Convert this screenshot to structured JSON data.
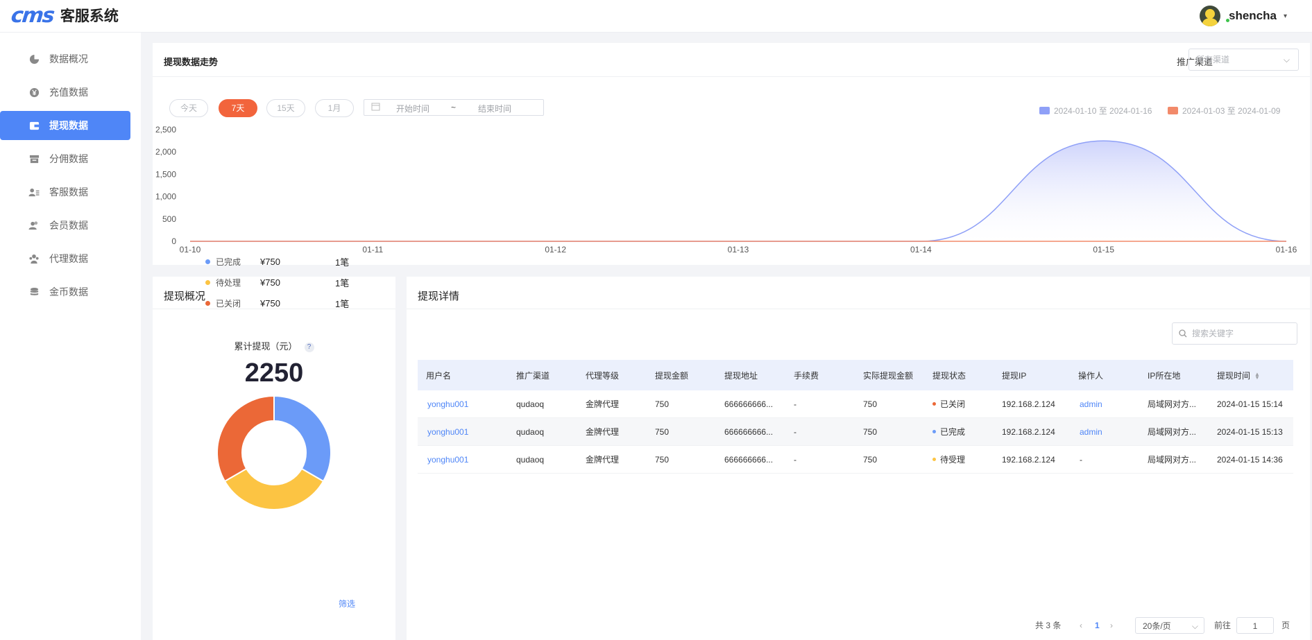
{
  "app": {
    "logo_mark": "cms",
    "title": "客服系统"
  },
  "user": {
    "name": "shencha",
    "caret": "▾"
  },
  "sidebar": {
    "items": [
      {
        "label": "数据概况",
        "icon": "pie-chart-icon",
        "active": false
      },
      {
        "label": "充值数据",
        "icon": "yen-coin-icon",
        "active": false
      },
      {
        "label": "提现数据",
        "icon": "wallet-icon",
        "active": true
      },
      {
        "label": "分佣数据",
        "icon": "archive-box-icon",
        "active": false
      },
      {
        "label": "客服数据",
        "icon": "user-list-icon",
        "active": false
      },
      {
        "label": "会员数据",
        "icon": "users-icon",
        "active": false
      },
      {
        "label": "代理数据",
        "icon": "agent-group-icon",
        "active": false
      },
      {
        "label": "金币数据",
        "icon": "coin-stack-icon",
        "active": false
      }
    ]
  },
  "trend": {
    "title": "提现数据走势",
    "channel_label": "推广渠道",
    "channel_select": {
      "value": "所有渠道"
    },
    "ranges": [
      "今天",
      "7天",
      "15天",
      "1月"
    ],
    "active_range": "7天",
    "date_range": {
      "start_placeholder": "开始时间",
      "separator": "~",
      "end_placeholder": "结束时间"
    }
  },
  "chart_data": {
    "type": "area",
    "x": [
      "01-10",
      "01-11",
      "01-12",
      "01-13",
      "01-14",
      "01-15",
      "01-16"
    ],
    "series": [
      {
        "name": "2024-01-10 至 2024-01-16",
        "values": [
          0,
          0,
          0,
          0,
          0,
          2250,
          0
        ],
        "color": "#8fa0f7"
      },
      {
        "name": "2024-01-03 至 2024-01-09",
        "values": [
          0,
          0,
          0,
          0,
          0,
          0,
          0
        ],
        "color": "#f28a6a"
      }
    ],
    "yticks": [
      "2,500",
      "2,000",
      "1,500",
      "1,000",
      "500",
      "0"
    ],
    "ylim": [
      0,
      2500
    ],
    "grid": false,
    "legend": "top-right",
    "smooth": true
  },
  "summary": {
    "title": "提现概况",
    "total_label": "累计提现（元）",
    "help": "?",
    "total": "2250",
    "donut": [
      {
        "label": "已完成",
        "value": 750,
        "color": "#6b9bf8"
      },
      {
        "label": "待处理",
        "value": 750,
        "color": "#fcc443"
      },
      {
        "label": "已关闭",
        "value": 750,
        "color": "#eb6837"
      }
    ],
    "stats": [
      {
        "label": "已完成",
        "amount": "¥750",
        "count": "1笔",
        "color": "#6b9bf8"
      },
      {
        "label": "待处理",
        "amount": "¥750",
        "count": "1笔",
        "color": "#fcc443"
      },
      {
        "label": "已关闭",
        "amount": "¥750",
        "count": "1笔",
        "color": "#eb6837"
      }
    ],
    "filter_label": "筛选"
  },
  "detail": {
    "title": "提现详情",
    "search_placeholder": "搜索关键字",
    "columns": [
      "用户名",
      "推广渠道",
      "代理等级",
      "提现金额",
      "提现地址",
      "手续费",
      "实际提现金额",
      "提现状态",
      "提现IP",
      "操作人",
      "IP所在地",
      "提现时间"
    ],
    "rows": [
      {
        "user": "yonghu001",
        "channel": "qudaoq",
        "level": "金牌代理",
        "amount": "750",
        "address": "666666666...",
        "fee": "-",
        "actual": "750",
        "status": "已关闭",
        "status_color": "#eb6837",
        "ip": "192.168.2.124",
        "operator": "admin",
        "location": "局域网对方...",
        "time": "2024-01-15 15:14"
      },
      {
        "user": "yonghu001",
        "channel": "qudaoq",
        "level": "金牌代理",
        "amount": "750",
        "address": "666666666...",
        "fee": "-",
        "actual": "750",
        "status": "已完成",
        "status_color": "#6b9bf8",
        "ip": "192.168.2.124",
        "operator": "admin",
        "location": "局域网对方...",
        "time": "2024-01-15 15:13"
      },
      {
        "user": "yonghu001",
        "channel": "qudaoq",
        "level": "金牌代理",
        "amount": "750",
        "address": "666666666...",
        "fee": "-",
        "actual": "750",
        "status": "待受理",
        "status_color": "#fcc443",
        "ip": "192.168.2.124",
        "operator": "-",
        "location": "局域网对方...",
        "time": "2024-01-15 14:36"
      }
    ],
    "pagination": {
      "total": "共 3 条",
      "prev": "‹",
      "page": "1",
      "next": "›",
      "page_size": "20条/页",
      "goto_label": "前往",
      "goto_value": "1",
      "goto_suffix": "页"
    }
  }
}
